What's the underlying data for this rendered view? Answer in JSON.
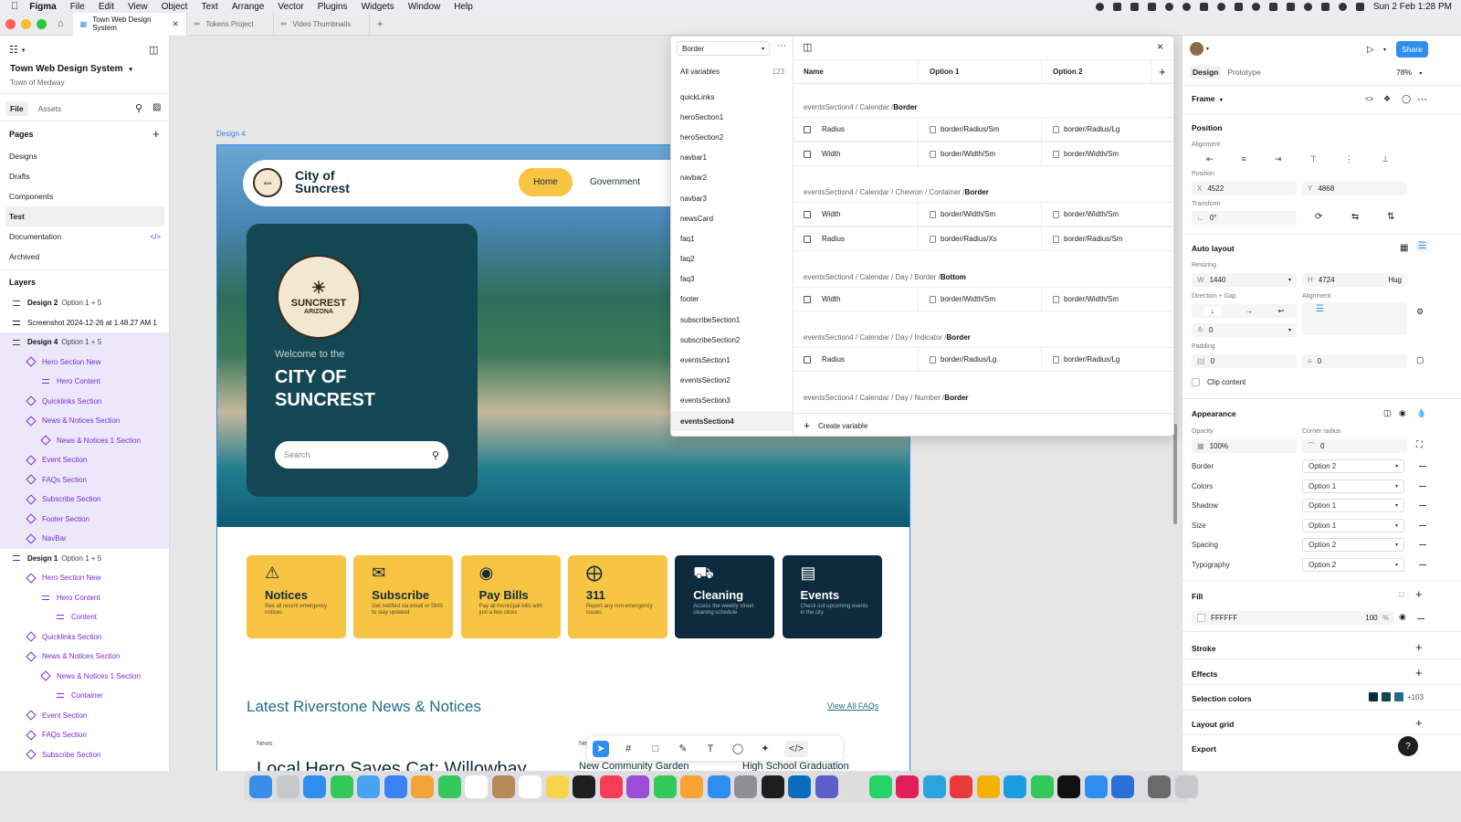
{
  "menubar": {
    "app": "Figma",
    "items": [
      "File",
      "Edit",
      "View",
      "Object",
      "Text",
      "Arrange",
      "Vector",
      "Plugins",
      "Widgets",
      "Window",
      "Help"
    ],
    "clock": "Sun 2 Feb  1:28 PM"
  },
  "tabs": [
    {
      "label": "Town Web Design System"
    },
    {
      "label": "Tokens Project"
    },
    {
      "label": "Video Thumbnails"
    }
  ],
  "left_panel": {
    "file_name": "Town Web Design System",
    "team": "Town of Medway",
    "tab_file": "File",
    "tab_assets": "Assets",
    "pages_heading": "Pages",
    "pages": [
      "Designs",
      "Drafts",
      "Components",
      "Test",
      "Documentation",
      "Archived"
    ],
    "layers_heading": "Layers",
    "layers": [
      {
        "label": "Design 2",
        "tag": "Option 1 + 5",
        "indent": 0,
        "kind": "frame"
      },
      {
        "label": "Screenshot 2024-12-26 at 1.48.27 AM 1",
        "tag": "",
        "indent": 0,
        "kind": "image"
      },
      {
        "label": "Design 4",
        "tag": "Option 1 + 5",
        "indent": 0,
        "kind": "frame"
      },
      {
        "label": "Hero Section New",
        "tag": "",
        "indent": 1,
        "kind": "comp"
      },
      {
        "label": "Hero Content",
        "tag": "",
        "indent": 2,
        "kind": "line"
      },
      {
        "label": "Quicklinks Section",
        "tag": "",
        "indent": 1,
        "kind": "comp"
      },
      {
        "label": "News & Notices Section",
        "tag": "",
        "indent": 1,
        "kind": "comp"
      },
      {
        "label": "News & Notices 1 Section",
        "tag": "",
        "indent": 2,
        "kind": "comp"
      },
      {
        "label": "Event Section",
        "tag": "",
        "indent": 1,
        "kind": "comp"
      },
      {
        "label": "FAQs Section",
        "tag": "",
        "indent": 1,
        "kind": "comp"
      },
      {
        "label": "Subscribe Section",
        "tag": "",
        "indent": 1,
        "kind": "comp"
      },
      {
        "label": "Footer Section",
        "tag": "",
        "indent": 1,
        "kind": "comp"
      },
      {
        "label": "NavBar",
        "tag": "",
        "indent": 1,
        "kind": "comp"
      },
      {
        "label": "Design 1",
        "tag": "Option 1 + 5",
        "indent": 0,
        "kind": "frame"
      },
      {
        "label": "Hero Section New",
        "tag": "",
        "indent": 1,
        "kind": "comp"
      },
      {
        "label": "Hero Content",
        "tag": "",
        "indent": 2,
        "kind": "line"
      },
      {
        "label": "Content",
        "tag": "",
        "indent": 3,
        "kind": "line"
      },
      {
        "label": "Quicklinks Section",
        "tag": "",
        "indent": 1,
        "kind": "comp"
      },
      {
        "label": "News & Notices Section",
        "tag": "",
        "indent": 1,
        "kind": "comp"
      },
      {
        "label": "News & Notices 1 Section",
        "tag": "",
        "indent": 2,
        "kind": "comp"
      },
      {
        "label": "Container",
        "tag": "",
        "indent": 3,
        "kind": "line"
      },
      {
        "label": "Event Section",
        "tag": "",
        "indent": 1,
        "kind": "comp"
      },
      {
        "label": "FAQs Section",
        "tag": "",
        "indent": 1,
        "kind": "comp"
      },
      {
        "label": "Subscribe Section",
        "tag": "",
        "indent": 1,
        "kind": "comp"
      }
    ]
  },
  "canvas": {
    "frame_label": "Design 4",
    "site": {
      "logo_line1": "City of",
      "logo_line2": "Suncrest",
      "nav_home": "Home",
      "nav_government": "Government",
      "seal_text": "SUNCREST",
      "seal_sub": "ARIZONA",
      "welcome": "Welcome to the",
      "hero_title_1": "CITY OF",
      "hero_title_2": "SUNCREST",
      "search_placeholder": "Search",
      "cards": [
        {
          "title": "Notices",
          "desc": "See all recent emergency notices",
          "dark": false
        },
        {
          "title": "Subscribe",
          "desc": "Get notified via email or SMS to stay updated",
          "dark": false
        },
        {
          "title": "Pay Bills",
          "desc": "Pay all municipal bills with just a few clicks",
          "dark": false
        },
        {
          "title": "311",
          "desc": "Report any non-emergency issues",
          "dark": false
        },
        {
          "title": "Cleaning",
          "desc": "Access the weekly street cleaning schedule",
          "dark": true
        },
        {
          "title": "Events",
          "desc": "Check out upcoming events in the city",
          "dark": true
        }
      ],
      "news_heading": "Latest Riverstone News & Notices",
      "view_all": "View All FAQs",
      "news_tag": "News",
      "news_tag2": "Ne",
      "news_1": "Local Hero Saves Cat: Willowbay",
      "news_2": "New Community Garden",
      "news_3": "High School Graduation"
    }
  },
  "variables": {
    "collection_select": "Border",
    "all_label": "All variables",
    "all_count": "123",
    "collections": [
      "quickLinks",
      "heroSection1",
      "heroSection2",
      "navbar1",
      "navbar2",
      "navbar3",
      "newsCard",
      "faq1",
      "faq2",
      "faq3",
      "footer",
      "subscribeSection1",
      "subscribeSection2",
      "eventsSection1",
      "eventsSection2",
      "eventsSection3",
      "eventsSection4"
    ],
    "col_name": "Name",
    "col_opt1": "Option 1",
    "col_opt2": "Option 2",
    "groups": [
      {
        "path": "eventsSection4 / Calendar / ",
        "leaf": "Border",
        "rows": [
          {
            "name": "Radius",
            "o1": "border/Radius/Sm",
            "o2": "border/Radius/Lg"
          },
          {
            "name": "Width",
            "o1": "border/Width/Sm",
            "o2": "border/Width/Sm"
          }
        ]
      },
      {
        "path": "eventsSection4 / Calendar / Chevron / Container / ",
        "leaf": "Border",
        "rows": [
          {
            "name": "Width",
            "o1": "border/Width/Sm",
            "o2": "border/Width/Sm"
          },
          {
            "name": "Radius",
            "o1": "border/Radius/Xs",
            "o2": "border/Radius/Sm"
          }
        ]
      },
      {
        "path": "eventsSection4 / Calendar / Day / Border / ",
        "leaf": "Bottom",
        "rows": [
          {
            "name": "Width",
            "o1": "border/Width/Sm",
            "o2": "border/Width/Sm"
          }
        ]
      },
      {
        "path": "eventsSection4 / Calendar / Day / Indicator / ",
        "leaf": "Border",
        "rows": [
          {
            "name": "Radius",
            "o1": "border/Radius/Lg",
            "o2": "border/Radius/Lg"
          }
        ]
      },
      {
        "path": "eventsSection4 / Calendar / Day / Number / ",
        "leaf": "Border",
        "rows": []
      }
    ],
    "create_label": "Create variable"
  },
  "right_panel": {
    "share": "Share",
    "tab_design": "Design",
    "tab_prototype": "Prototype",
    "zoom": "78%",
    "frame_label": "Frame",
    "position_h": "Position",
    "alignment_l": "Alignment",
    "position_l": "Position",
    "x_label": "X",
    "x_value": "4522",
    "y_label": "Y",
    "y_value": "4868",
    "transform_l": "Transform",
    "rotation": "0°",
    "autolayout_h": "Auto layout",
    "resizing_l": "Resizing",
    "w_label": "W",
    "w_value": "1440",
    "h_label": "H",
    "h_value": "4724",
    "hug": "Hug",
    "direction_l": "Direction + Gap",
    "align_l": "Alignment",
    "gap_value": "0",
    "padding_l": "Padding",
    "pad_h": "0",
    "pad_v": "0",
    "clip": "Clip content",
    "appearance_h": "Appearance",
    "opacity_l": "Opacity",
    "opacity": "100%",
    "radius_l": "Corner radius",
    "radius": "0",
    "modes": [
      {
        "label": "Border",
        "value": "Option 2"
      },
      {
        "label": "Colors",
        "value": "Option 1"
      },
      {
        "label": "Shadow",
        "value": "Option 1"
      },
      {
        "label": "Size",
        "value": "Option 1"
      },
      {
        "label": "Spacing",
        "value": "Option 2"
      },
      {
        "label": "Typography",
        "value": "Option 2"
      }
    ],
    "fill_h": "Fill",
    "fill_hex": "FFFFFF",
    "fill_opacity": "100",
    "pct": "%",
    "stroke_h": "Stroke",
    "effects_h": "Effects",
    "selection_colors_h": "Selection colors",
    "selection_more": "+103",
    "layout_grid_h": "Layout grid",
    "export_h": "Export",
    "help": "?"
  },
  "colors": {
    "accent": "#2F8DF0",
    "teal_dark": "#134753",
    "navy_card": "#0E2A3D",
    "yellow_card": "#F8C443",
    "component_purple": "#7A2BD2"
  }
}
